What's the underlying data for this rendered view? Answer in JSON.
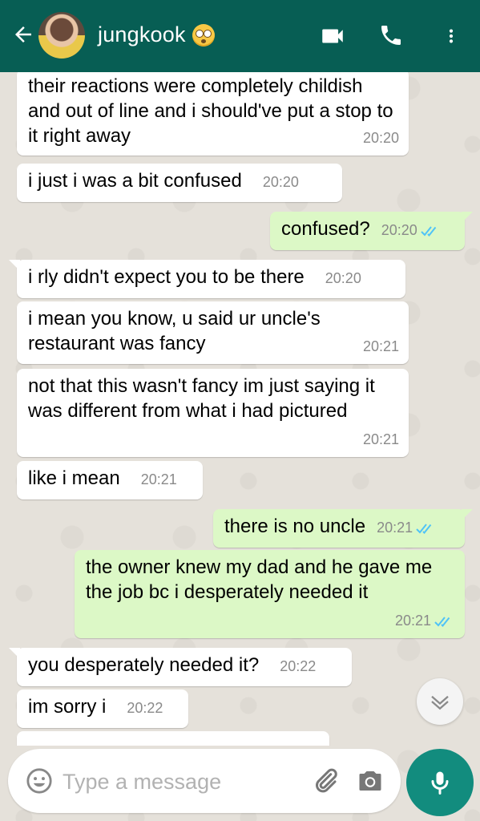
{
  "header": {
    "contact_name": "jungkook"
  },
  "input": {
    "placeholder": "Type a message"
  },
  "messages": [
    {
      "dir": "in",
      "text": "their reactions were completely childish and out of line and i should've put a stop to it right away",
      "time": "20:20"
    },
    {
      "dir": "in",
      "text": "i just i was a bit confused",
      "time": "20:20"
    },
    {
      "dir": "out",
      "text": "confused?",
      "time": "20:20"
    },
    {
      "dir": "in",
      "text": "i rly didn't expect you to be there",
      "time": "20:20"
    },
    {
      "dir": "in",
      "text": "i mean you know, u said ur uncle's restaurant was fancy",
      "time": "20:21"
    },
    {
      "dir": "in",
      "text": "not that this wasn't fancy im just saying it was different from what i had pictured",
      "time": "20:21"
    },
    {
      "dir": "in",
      "text": "like i mean",
      "time": "20:21"
    },
    {
      "dir": "out",
      "text": "there is no uncle",
      "time": "20:21"
    },
    {
      "dir": "out",
      "text": "the owner knew my dad and he gave me the job bc i desperately needed it",
      "time": "20:21"
    },
    {
      "dir": "in",
      "text": "you desperately needed it?",
      "time": "20:22"
    },
    {
      "dir": "in",
      "text": "im sorry i",
      "time": "20:22"
    }
  ],
  "colors": {
    "header": "#075e54",
    "outgoing_bubble": "#dcf8c6",
    "incoming_bubble": "#ffffff",
    "read_ticks": "#4fc3f7",
    "mic_button": "#128c7e"
  },
  "icons": [
    "back-arrow-icon",
    "video-call-icon",
    "phone-icon",
    "more-vert-icon",
    "chevron-down-icon",
    "emoji-icon",
    "attach-icon",
    "camera-icon",
    "mic-icon",
    "double-tick-icon"
  ]
}
